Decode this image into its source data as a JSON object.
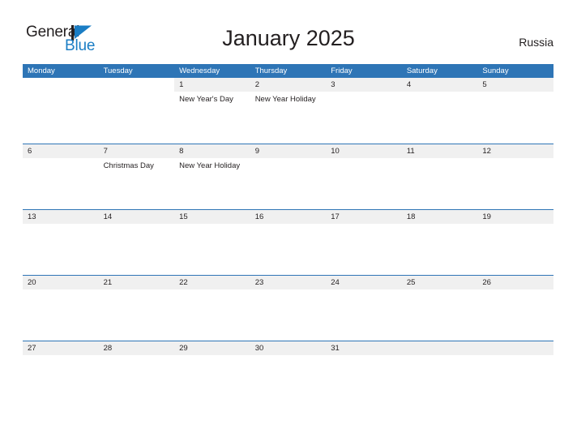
{
  "brand": {
    "name_part1": "General",
    "name_part2": "Blue",
    "logo_icon": "triangle-flag-icon",
    "accent_color": "#1a7dc4",
    "dark_color": "#231f20"
  },
  "header": {
    "title": "January 2025",
    "region": "Russia"
  },
  "theme": {
    "header_band_color": "#2e75b6",
    "date_band_color": "#f0f0f0",
    "row_divider_color": "#2e75b6",
    "page_background": "#ffffff"
  },
  "calendar": {
    "month": "January",
    "year": "2025",
    "weekday_headers": [
      "Monday",
      "Tuesday",
      "Wednesday",
      "Thursday",
      "Friday",
      "Saturday",
      "Sunday"
    ],
    "weeks": [
      [
        {
          "day": "",
          "events": [],
          "state": "empty"
        },
        {
          "day": "",
          "events": [],
          "state": "empty"
        },
        {
          "day": "1",
          "events": [
            "New Year's Day"
          ],
          "state": "day"
        },
        {
          "day": "2",
          "events": [
            "New Year Holiday"
          ],
          "state": "day"
        },
        {
          "day": "3",
          "events": [],
          "state": "day"
        },
        {
          "day": "4",
          "events": [],
          "state": "day"
        },
        {
          "day": "5",
          "events": [],
          "state": "day"
        }
      ],
      [
        {
          "day": "6",
          "events": [],
          "state": "day"
        },
        {
          "day": "7",
          "events": [
            "Christmas Day"
          ],
          "state": "day"
        },
        {
          "day": "8",
          "events": [
            "New Year Holiday"
          ],
          "state": "day"
        },
        {
          "day": "9",
          "events": [],
          "state": "day"
        },
        {
          "day": "10",
          "events": [],
          "state": "day"
        },
        {
          "day": "11",
          "events": [],
          "state": "day"
        },
        {
          "day": "12",
          "events": [],
          "state": "day"
        }
      ],
      [
        {
          "day": "13",
          "events": [],
          "state": "day"
        },
        {
          "day": "14",
          "events": [],
          "state": "day"
        },
        {
          "day": "15",
          "events": [],
          "state": "day"
        },
        {
          "day": "16",
          "events": [],
          "state": "day"
        },
        {
          "day": "17",
          "events": [],
          "state": "day"
        },
        {
          "day": "18",
          "events": [],
          "state": "day"
        },
        {
          "day": "19",
          "events": [],
          "state": "day"
        }
      ],
      [
        {
          "day": "20",
          "events": [],
          "state": "day"
        },
        {
          "day": "21",
          "events": [],
          "state": "day"
        },
        {
          "day": "22",
          "events": [],
          "state": "day"
        },
        {
          "day": "23",
          "events": [],
          "state": "day"
        },
        {
          "day": "24",
          "events": [],
          "state": "day"
        },
        {
          "day": "25",
          "events": [],
          "state": "day"
        },
        {
          "day": "26",
          "events": [],
          "state": "day"
        }
      ],
      [
        {
          "day": "27",
          "events": [],
          "state": "day"
        },
        {
          "day": "28",
          "events": [],
          "state": "day"
        },
        {
          "day": "29",
          "events": [],
          "state": "day"
        },
        {
          "day": "30",
          "events": [],
          "state": "day"
        },
        {
          "day": "31",
          "events": [],
          "state": "day"
        },
        {
          "day": "",
          "events": [],
          "state": "blank"
        },
        {
          "day": "",
          "events": [],
          "state": "blank"
        }
      ]
    ]
  }
}
